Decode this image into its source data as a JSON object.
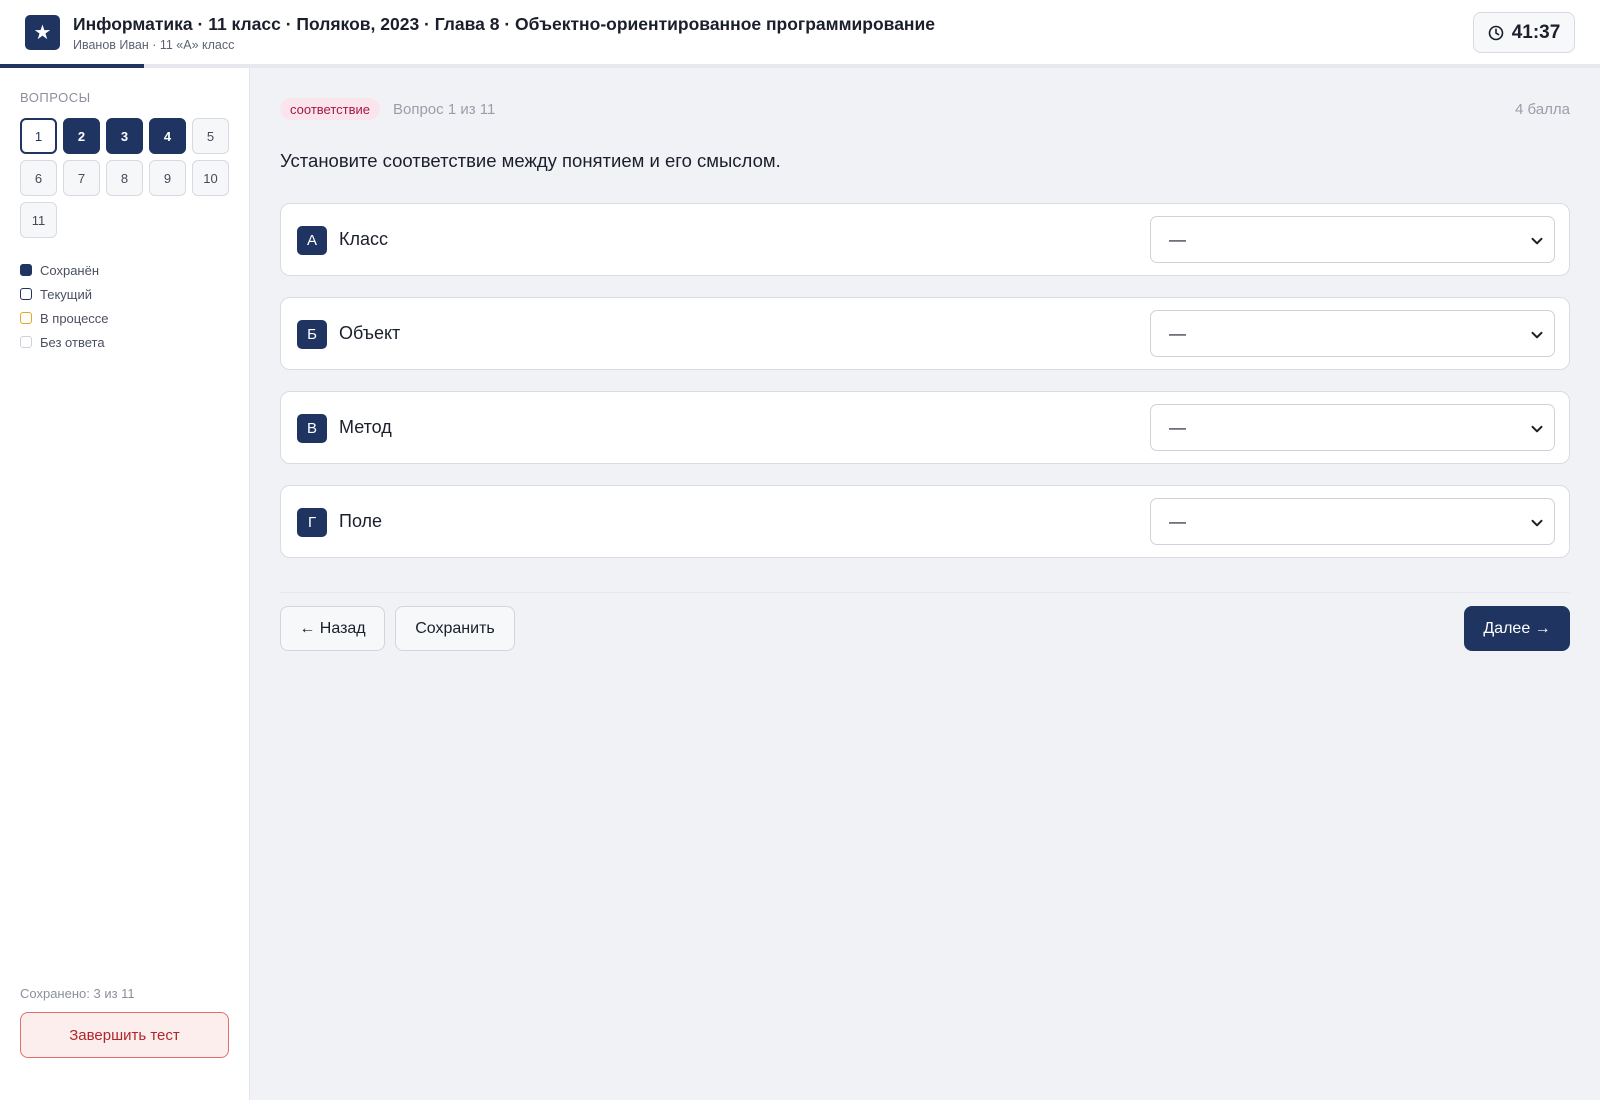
{
  "header": {
    "title": "Информатика · 11 класс · Поляков, 2023 · Глава 8 · Объектно-ориентированное программирование",
    "subtitle": "Иванов Иван · 11 «А» класс",
    "timer": "41:37",
    "progress_fraction": 0.09
  },
  "sidebar": {
    "heading": "Вопросы",
    "questions": [
      {
        "label": "1",
        "state": "current"
      },
      {
        "label": "2",
        "state": "saved"
      },
      {
        "label": "3",
        "state": "saved"
      },
      {
        "label": "4",
        "state": "saved"
      },
      {
        "label": "5",
        "state": "none"
      },
      {
        "label": "6",
        "state": "none"
      },
      {
        "label": "7",
        "state": "none"
      },
      {
        "label": "8",
        "state": "none"
      },
      {
        "label": "9",
        "state": "none"
      },
      {
        "label": "10",
        "state": "none"
      },
      {
        "label": "11",
        "state": "none"
      }
    ],
    "legend": [
      {
        "label": "Сохранён",
        "state": "saved"
      },
      {
        "label": "Текущий",
        "state": "current"
      },
      {
        "label": "В процессе",
        "state": "inprogress"
      },
      {
        "label": "Без ответа",
        "state": "noanswer"
      }
    ],
    "saved_count": "Сохранено: 3 из 11",
    "finish_label": "Завершить тест"
  },
  "question": {
    "type_tag": "соответствие",
    "counter": "Вопрос 1 из 11",
    "points": "4 балла",
    "text": "Установите соответствие между понятием и его смыслом.",
    "rows": [
      {
        "letter": "А",
        "label": "Класс",
        "value": "—"
      },
      {
        "letter": "Б",
        "label": "Объект",
        "value": "—"
      },
      {
        "letter": "В",
        "label": "Метод",
        "value": "—"
      },
      {
        "letter": "Г",
        "label": "Поле",
        "value": "—"
      }
    ]
  },
  "actions": {
    "back_label": "← Назад",
    "save_label": "Сохранить",
    "next_label": "Далее →"
  },
  "colors": {
    "accent": "#1f3461",
    "tag_bg": "#fbe5ec",
    "tag_text": "#a3184a",
    "finish_border": "#e26d6d",
    "in_progress": "#e5a721"
  }
}
